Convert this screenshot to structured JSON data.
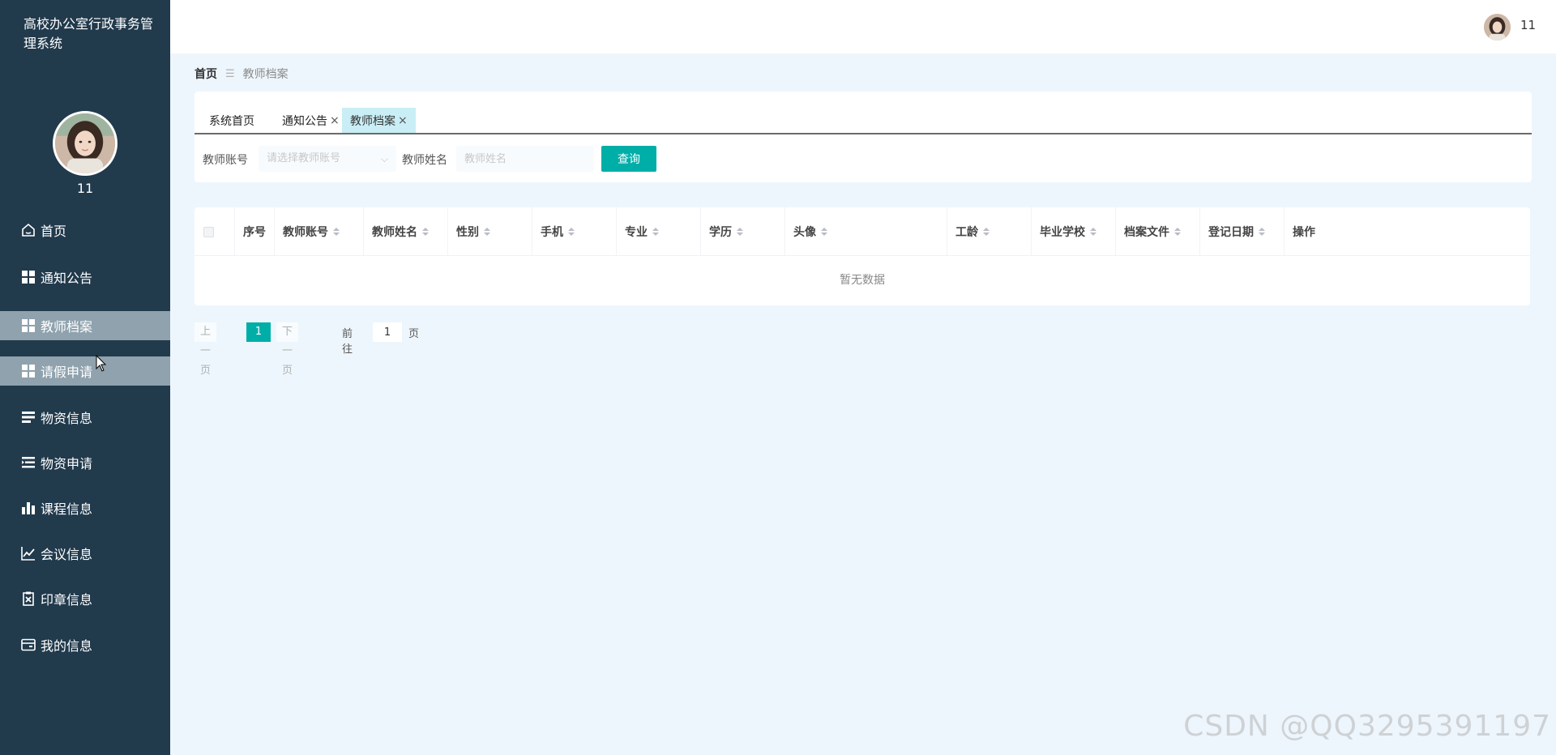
{
  "app": {
    "title": "高校办公室行政事务管理系统"
  },
  "user": {
    "name": "11"
  },
  "sidebar": {
    "items": [
      {
        "label": "首页",
        "icon": "home-icon"
      },
      {
        "label": "通知公告",
        "icon": "grid-icon"
      },
      {
        "label": "教师档案",
        "icon": "grid-icon",
        "active": true
      },
      {
        "label": "请假申请",
        "icon": "grid-icon",
        "hover": true
      },
      {
        "label": "物资信息",
        "icon": "list-icon"
      },
      {
        "label": "物资申请",
        "icon": "list-indent-icon"
      },
      {
        "label": "课程信息",
        "icon": "bar-chart-icon"
      },
      {
        "label": "会议信息",
        "icon": "line-chart-icon"
      },
      {
        "label": "印章信息",
        "icon": "clipboard-x-icon"
      },
      {
        "label": "我的信息",
        "icon": "card-icon"
      }
    ]
  },
  "breadcrumb": {
    "home": "首页",
    "separator": "☰",
    "current": "教师档案"
  },
  "tabs": [
    {
      "label": "系统首页",
      "closable": false
    },
    {
      "label": "通知公告",
      "closable": true,
      "close": "×"
    },
    {
      "label": "教师档案",
      "closable": true,
      "close": "×",
      "active": true
    }
  ],
  "search": {
    "account_label": "教师账号",
    "account_placeholder": "请选择教师账号",
    "name_label": "教师姓名",
    "name_placeholder": "教师姓名",
    "button": "查询"
  },
  "table": {
    "columns": [
      "序号",
      "教师账号",
      "教师姓名",
      "性别",
      "手机",
      "专业",
      "学历",
      "头像",
      "工龄",
      "毕业学校",
      "档案文件",
      "登记日期",
      "操作"
    ],
    "empty_text": "暂无数据"
  },
  "pagination": {
    "prev": "上一页",
    "current_page": "1",
    "next": "下一页",
    "goto_label": "前往",
    "goto_value": "1",
    "page_suffix": "页"
  },
  "watermark": "CSDN @QQ3295391197",
  "colors": {
    "sidebar_bg": "#213a4c",
    "accent": "#00aea8",
    "active_menu": "#8fa2ad",
    "page_bg": "#eef6fd"
  }
}
